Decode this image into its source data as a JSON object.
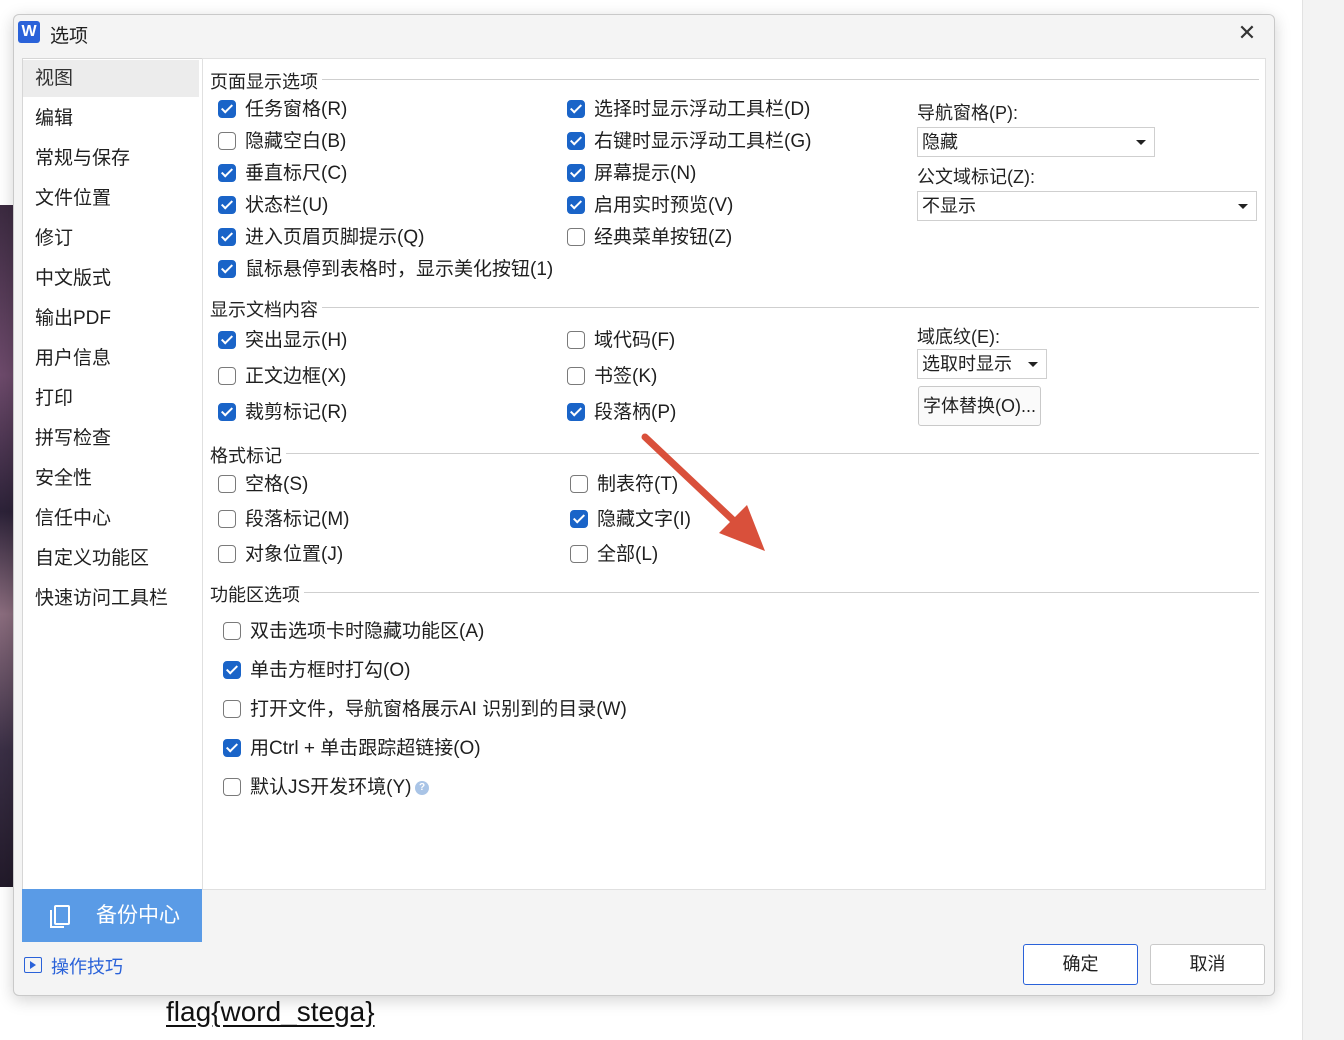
{
  "dialog": {
    "app_icon_letter": "W",
    "title": "选项",
    "close_glyph": "✕"
  },
  "sidebar": {
    "items": [
      "视图",
      "编辑",
      "常规与保存",
      "文件位置",
      "修订",
      "中文版式",
      "输出PDF",
      "用户信息",
      "打印",
      "拼写检查",
      "安全性",
      "信任中心",
      "自定义功能区",
      "快速访问工具栏"
    ],
    "selected": "视图",
    "backup_label": "备份中心",
    "tips_label": "操作技巧"
  },
  "page_display": {
    "title": "页面显示选项",
    "left": [
      {
        "label": "任务窗格(R)",
        "checked": true
      },
      {
        "label": "隐藏空白(B)",
        "checked": false
      },
      {
        "label": "垂直标尺(C)",
        "checked": true
      },
      {
        "label": "状态栏(U)",
        "checked": true
      },
      {
        "label": "进入页眉页脚提示(Q)",
        "checked": true
      },
      {
        "label": "鼠标悬停到表格时，显示美化按钮(1)",
        "checked": true
      }
    ],
    "middle": [
      {
        "label": "选择时显示浮动工具栏(D)",
        "checked": true
      },
      {
        "label": "右键时显示浮动工具栏(G)",
        "checked": true
      },
      {
        "label": "屏幕提示(N)",
        "checked": true
      },
      {
        "label": "启用实时预览(V)",
        "checked": true
      },
      {
        "label": "经典菜单按钮(Z)",
        "checked": false
      }
    ],
    "nav_pane_label": "导航窗格(P):",
    "nav_pane_value": "隐藏",
    "doc_field_label": "公文域标记(Z):",
    "doc_field_value": "不显示"
  },
  "show_doc_content": {
    "title": "显示文档内容",
    "left": [
      {
        "label": "突出显示(H)",
        "checked": true
      },
      {
        "label": "正文边框(X)",
        "checked": false
      },
      {
        "label": "裁剪标记(R)",
        "checked": true
      }
    ],
    "middle": [
      {
        "label": "域代码(F)",
        "checked": false
      },
      {
        "label": "书签(K)",
        "checked": false
      },
      {
        "label": "段落柄(P)",
        "checked": true
      }
    ],
    "field_shading_label": "域底纹(E):",
    "field_shading_value": "选取时显示",
    "font_sub_button": "字体替换(O)..."
  },
  "format_marks": {
    "title": "格式标记",
    "left": [
      {
        "label": "空格(S)",
        "checked": false
      },
      {
        "label": "段落标记(M)",
        "checked": false
      },
      {
        "label": "对象位置(J)",
        "checked": false
      }
    ],
    "middle": [
      {
        "label": "制表符(T)",
        "checked": false
      },
      {
        "label": "隐藏文字(I)",
        "checked": true
      },
      {
        "label": "全部(L)",
        "checked": false
      }
    ]
  },
  "ribbon_options": {
    "title": "功能区选项",
    "items": [
      {
        "label": "双击选项卡时隐藏功能区(A)",
        "checked": false
      },
      {
        "label": "单击方框时打勾(O)",
        "checked": true
      },
      {
        "label": "打开文件，导航窗格展示AI 识别到的目录(W)",
        "checked": false
      },
      {
        "label": "用Ctrl + 单击跟踪超链接(O)",
        "checked": true
      },
      {
        "label": "默认JS开发环境(Y)",
        "checked": false
      }
    ],
    "help_glyph": "?"
  },
  "footer": {
    "ok": "确定",
    "cancel": "取消"
  },
  "annotation": {
    "arrow_color": "#d9503b"
  },
  "background": {
    "flag_text": "flag{word_stega}"
  }
}
